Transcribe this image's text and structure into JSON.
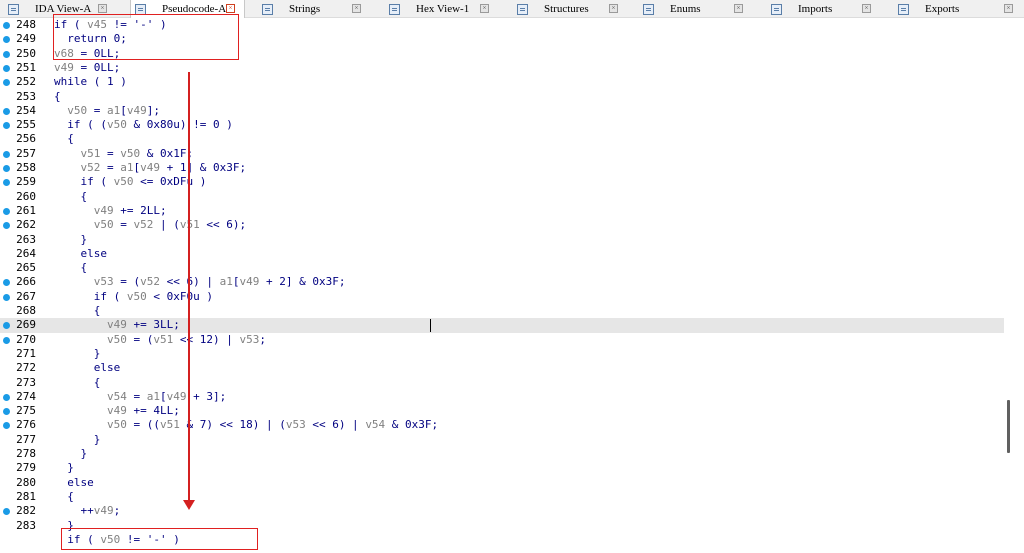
{
  "tabs": [
    {
      "label": "IDA View-A",
      "active": false
    },
    {
      "label": "Pseudocode-A",
      "active": true
    },
    {
      "label": "Strings",
      "active": false
    },
    {
      "label": "Hex View-1",
      "active": false
    },
    {
      "label": "Structures",
      "active": false
    },
    {
      "label": "Enums",
      "active": false
    },
    {
      "label": "Imports",
      "active": false
    },
    {
      "label": "Exports",
      "active": false
    }
  ],
  "code_lines": [
    {
      "num": "248",
      "bp": true,
      "text": "if ( v45 != '-' )"
    },
    {
      "num": "249",
      "bp": true,
      "text": "  return 0;"
    },
    {
      "num": "250",
      "bp": true,
      "text": "v68 = 0LL;"
    },
    {
      "num": "251",
      "bp": true,
      "text": "v49 = 0LL;"
    },
    {
      "num": "252",
      "bp": true,
      "text": "while ( 1 )"
    },
    {
      "num": "253",
      "bp": false,
      "text": "{"
    },
    {
      "num": "254",
      "bp": true,
      "text": "  v50 = a1[v49];"
    },
    {
      "num": "255",
      "bp": true,
      "text": "  if ( (v50 & 0x80u) != 0 )"
    },
    {
      "num": "256",
      "bp": false,
      "text": "  {"
    },
    {
      "num": "257",
      "bp": true,
      "text": "    v51 = v50 & 0x1F;"
    },
    {
      "num": "258",
      "bp": true,
      "text": "    v52 = a1[v49 + 1] & 0x3F;"
    },
    {
      "num": "259",
      "bp": true,
      "text": "    if ( v50 <= 0xDFu )"
    },
    {
      "num": "260",
      "bp": false,
      "text": "    {"
    },
    {
      "num": "261",
      "bp": true,
      "text": "      v49 += 2LL;"
    },
    {
      "num": "262",
      "bp": true,
      "text": "      v50 = v52 | (v51 << 6);"
    },
    {
      "num": "263",
      "bp": false,
      "text": "    }"
    },
    {
      "num": "264",
      "bp": false,
      "text": "    else"
    },
    {
      "num": "265",
      "bp": false,
      "text": "    {"
    },
    {
      "num": "266",
      "bp": true,
      "text": "      v53 = (v52 << 6) | a1[v49 + 2] & 0x3F;"
    },
    {
      "num": "267",
      "bp": true,
      "text": "      if ( v50 < 0xF0u )"
    },
    {
      "num": "268",
      "bp": false,
      "text": "      {"
    },
    {
      "num": "269",
      "bp": true,
      "text": "        v49 += 3LL;"
    },
    {
      "num": "270",
      "bp": true,
      "text": "        v50 = (v51 << 12) | v53;"
    },
    {
      "num": "271",
      "bp": false,
      "text": "      }"
    },
    {
      "num": "272",
      "bp": false,
      "text": "      else"
    },
    {
      "num": "273",
      "bp": false,
      "text": "      {"
    },
    {
      "num": "274",
      "bp": true,
      "text": "        v54 = a1[v49 + 3];"
    },
    {
      "num": "275",
      "bp": true,
      "text": "        v49 += 4LL;"
    },
    {
      "num": "276",
      "bp": true,
      "text": "        v50 = ((v51 & 7) << 18) | (v53 << 6) | v54 & 0x3F;"
    },
    {
      "num": "277",
      "bp": false,
      "text": "      }"
    },
    {
      "num": "278",
      "bp": false,
      "text": "    }"
    },
    {
      "num": "279",
      "bp": false,
      "text": "  }"
    },
    {
      "num": "280",
      "bp": false,
      "text": "  else"
    },
    {
      "num": "281",
      "bp": false,
      "text": "  {"
    },
    {
      "num": "282",
      "bp": true,
      "text": "    ++v49;"
    },
    {
      "num": "283",
      "bp": false,
      "text": "  }"
    },
    {
      "num": "",
      "bp": false,
      "text": "  if ( v50 != '-' )"
    }
  ],
  "highlighted_line": "269",
  "colors": {
    "breakpoint": "#1a9be6",
    "keyword": "#000080",
    "variable": "#808080",
    "annotation": "#e02020",
    "highlight": "#e6e6e6"
  }
}
